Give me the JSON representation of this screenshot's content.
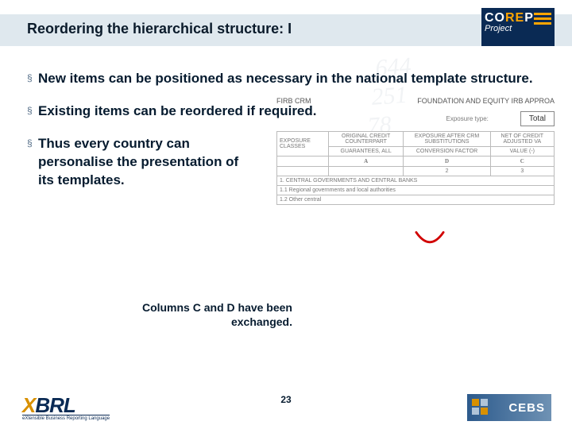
{
  "title": "Reordering the hierarchical structure: I",
  "bullets": [
    "New items can be positioned as necessary in the national template structure.",
    "Existing items can be reordered if required.",
    "Thus every country can personalise the presentation of its templates."
  ],
  "caption": "Columns C and D have been exchanged.",
  "page_number": "23",
  "logos": {
    "corep_line1a": "CO",
    "corep_line1b": "RE",
    "corep_line1c": "P",
    "corep_line2": "Project",
    "xbrl": "XBRL",
    "xbrl_sub": "eXtensible Business Reporting Language",
    "cebs": "CEBS"
  },
  "table": {
    "top_left": "FIRB CRM",
    "top_right": "FOUNDATION AND EQUITY IRB APPROA",
    "exposure": "Exposure type:",
    "total": "Total",
    "rowhdr": "EXPOSURE CLASSES",
    "col_headers": [
      "ORIGINAL CREDIT COUNTERPART",
      "EXPOSURE AFTER CRM SUBSTITUTIONS",
      "NET OF CREDIT ADJUSTED VA",
      "GUARANTEES, ALL",
      "CONVERSION FACTOR",
      "VALUE (-)"
    ],
    "big": [
      "A",
      "D",
      "C"
    ],
    "nums": [
      "",
      "2",
      "3"
    ],
    "rows": [
      "1. CENTRAL GOVERNMENTS AND CENTRAL BANKS",
      "1.1 Regional governments and local authorities",
      "1.2 Other central"
    ]
  },
  "bg_numbers": "  644\n 251\n78\n   1137\n 92"
}
